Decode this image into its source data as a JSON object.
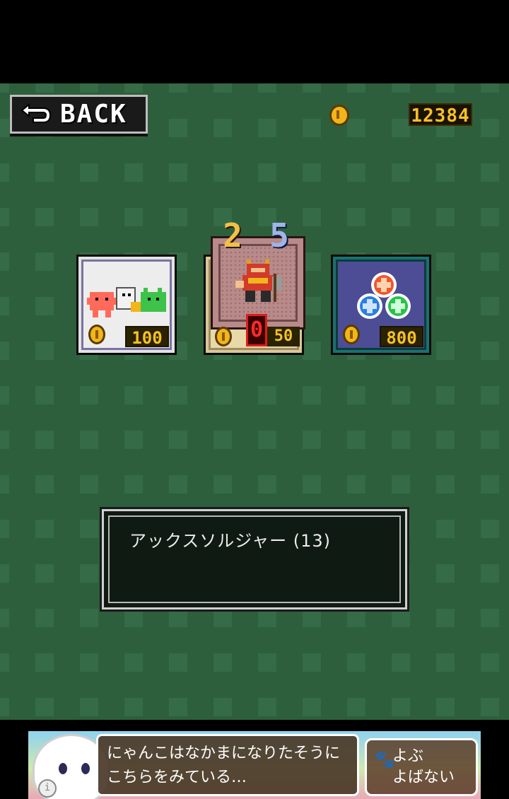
{
  "header": {
    "back_label": "BACK",
    "coin_total": "12384"
  },
  "shop": {
    "cards": [
      {
        "id": "team",
        "price": "100",
        "icon": "monster-team-icon"
      },
      {
        "id": "soldier",
        "price_fragment": "50",
        "icon": "axe-soldier-icon",
        "slot_left": "2",
        "slot_mid": "0",
        "slot_right": "5"
      },
      {
        "id": "orbs",
        "price": "800",
        "icon": "color-orbs-icon"
      }
    ]
  },
  "message": {
    "text": "アックスソルジャー (13)"
  },
  "ad": {
    "line1": "にゃんこはなかまになりたそうに",
    "line2": "こちらをみている…",
    "button_line1": "よぶ",
    "button_line2": "よばない",
    "info": "i"
  },
  "colors": {
    "board": "#356b47",
    "board_dark": "#2d5f3d",
    "coin": "#f2b51a",
    "price_text": "#f6c128",
    "slot_mid_red": "#e01c1c"
  }
}
